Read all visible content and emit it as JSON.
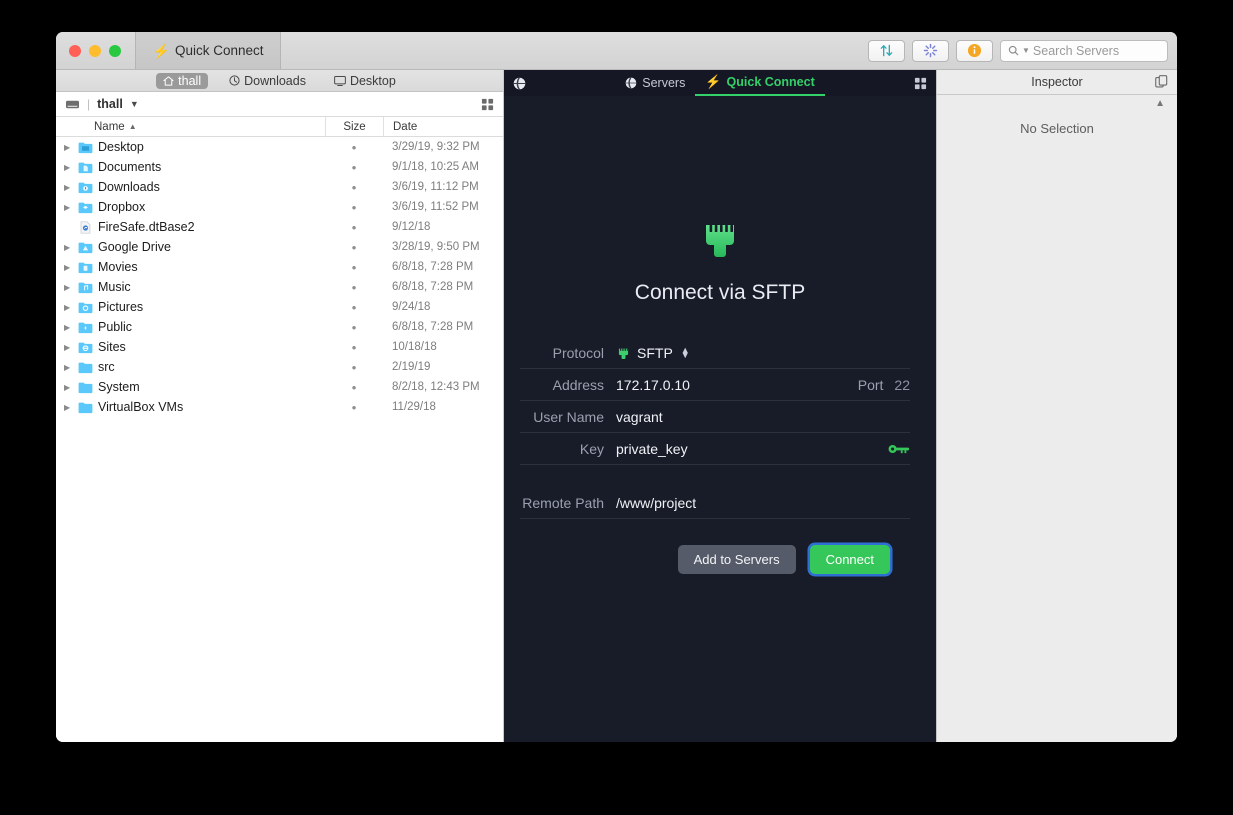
{
  "window": {
    "tab_title": "Quick Connect",
    "traffic_lights": [
      "close",
      "minimize",
      "zoom"
    ]
  },
  "toolbar": {
    "transfer_icon": "transfer-arrows-icon",
    "activity_icon": "spinner-icon",
    "info_icon": "info-icon",
    "search_placeholder": "Search Servers"
  },
  "favorites": [
    {
      "label": "thall",
      "icon": "home-icon",
      "selected": true
    },
    {
      "label": "Downloads",
      "icon": "clock-icon",
      "selected": false
    },
    {
      "label": "Desktop",
      "icon": "display-icon",
      "selected": false
    }
  ],
  "path_bar": {
    "drive_icon": "drive-icon",
    "name": "thall",
    "chevron": "chevron-down-icon",
    "grid_icon": "grid-view-icon"
  },
  "file_list": {
    "columns": {
      "name": "Name",
      "size": "Size",
      "date": "Date",
      "sort_arrow": "chevron-up-icon"
    },
    "rows": [
      {
        "name": "Desktop",
        "icon": "folder-desktop",
        "size": "•",
        "date": "3/29/19, 9:32 PM",
        "expandable": true
      },
      {
        "name": "Documents",
        "icon": "folder-documents",
        "size": "•",
        "date": "9/1/18, 10:25 AM",
        "expandable": true
      },
      {
        "name": "Downloads",
        "icon": "folder-downloads",
        "size": "•",
        "date": "3/6/19, 11:12 PM",
        "expandable": true
      },
      {
        "name": "Dropbox",
        "icon": "folder-dropbox",
        "size": "•",
        "date": "3/6/19, 11:52 PM",
        "expandable": true
      },
      {
        "name": "FireSafe.dtBase2",
        "icon": "document-file",
        "size": "•",
        "date": "9/12/18",
        "expandable": false
      },
      {
        "name": "Google Drive",
        "icon": "folder-gdrive",
        "size": "•",
        "date": "3/28/19, 9:50 PM",
        "expandable": true
      },
      {
        "name": "Movies",
        "icon": "folder-movies",
        "size": "•",
        "date": "6/8/18, 7:28 PM",
        "expandable": true
      },
      {
        "name": "Music",
        "icon": "folder-music",
        "size": "•",
        "date": "6/8/18, 7:28 PM",
        "expandable": true
      },
      {
        "name": "Pictures",
        "icon": "folder-pictures",
        "size": "•",
        "date": "9/24/18",
        "expandable": true
      },
      {
        "name": "Public",
        "icon": "folder-public",
        "size": "•",
        "date": "6/8/18, 7:28 PM",
        "expandable": true
      },
      {
        "name": "Sites",
        "icon": "folder-sites",
        "size": "•",
        "date": "10/18/18",
        "expandable": true
      },
      {
        "name": "src",
        "icon": "folder-plain",
        "size": "•",
        "date": "2/19/19",
        "expandable": true
      },
      {
        "name": "System",
        "icon": "folder-plain",
        "size": "•",
        "date": "8/2/18, 12:43 PM",
        "expandable": true
      },
      {
        "name": "VirtualBox VMs",
        "icon": "folder-plain",
        "size": "•",
        "date": "11/29/18",
        "expandable": true
      }
    ]
  },
  "dark_panel": {
    "tabs": [
      {
        "label": "Servers",
        "icon": "globe-icon",
        "active": false
      },
      {
        "label": "Quick Connect",
        "icon": "bolt-icon",
        "active": true
      }
    ],
    "leading_icon": "globe-icon",
    "grid_icon": "grid-view-icon",
    "hero": {
      "icon": "ethernet-connector-icon",
      "title": "Connect via SFTP"
    },
    "form": {
      "protocol": {
        "label": "Protocol",
        "value": "SFTP",
        "icon": "ethernet-connector-icon",
        "stepper": "stepper-icon"
      },
      "address": {
        "label": "Address",
        "value": "172.17.0.10"
      },
      "port": {
        "label": "Port",
        "value": "22"
      },
      "username": {
        "label": "User Name",
        "value": "vagrant"
      },
      "key": {
        "label": "Key",
        "value": "private_key",
        "icon": "key-icon"
      },
      "remote_path": {
        "label": "Remote Path",
        "value": "/www/project"
      }
    },
    "buttons": {
      "add_to_servers": "Add to Servers",
      "connect": "Connect"
    }
  },
  "inspector": {
    "title": "Inspector",
    "duplicate_icon": "duplicate-icon",
    "collapse_icon": "chevron-up-icon",
    "empty_text": "No Selection"
  },
  "colors": {
    "accent_green": "#35c759",
    "focus_blue": "#2f6fd4",
    "dark_bg": "#181c28",
    "tabbar_bg": "#151824",
    "folder_blue": "#5ac8fa"
  }
}
